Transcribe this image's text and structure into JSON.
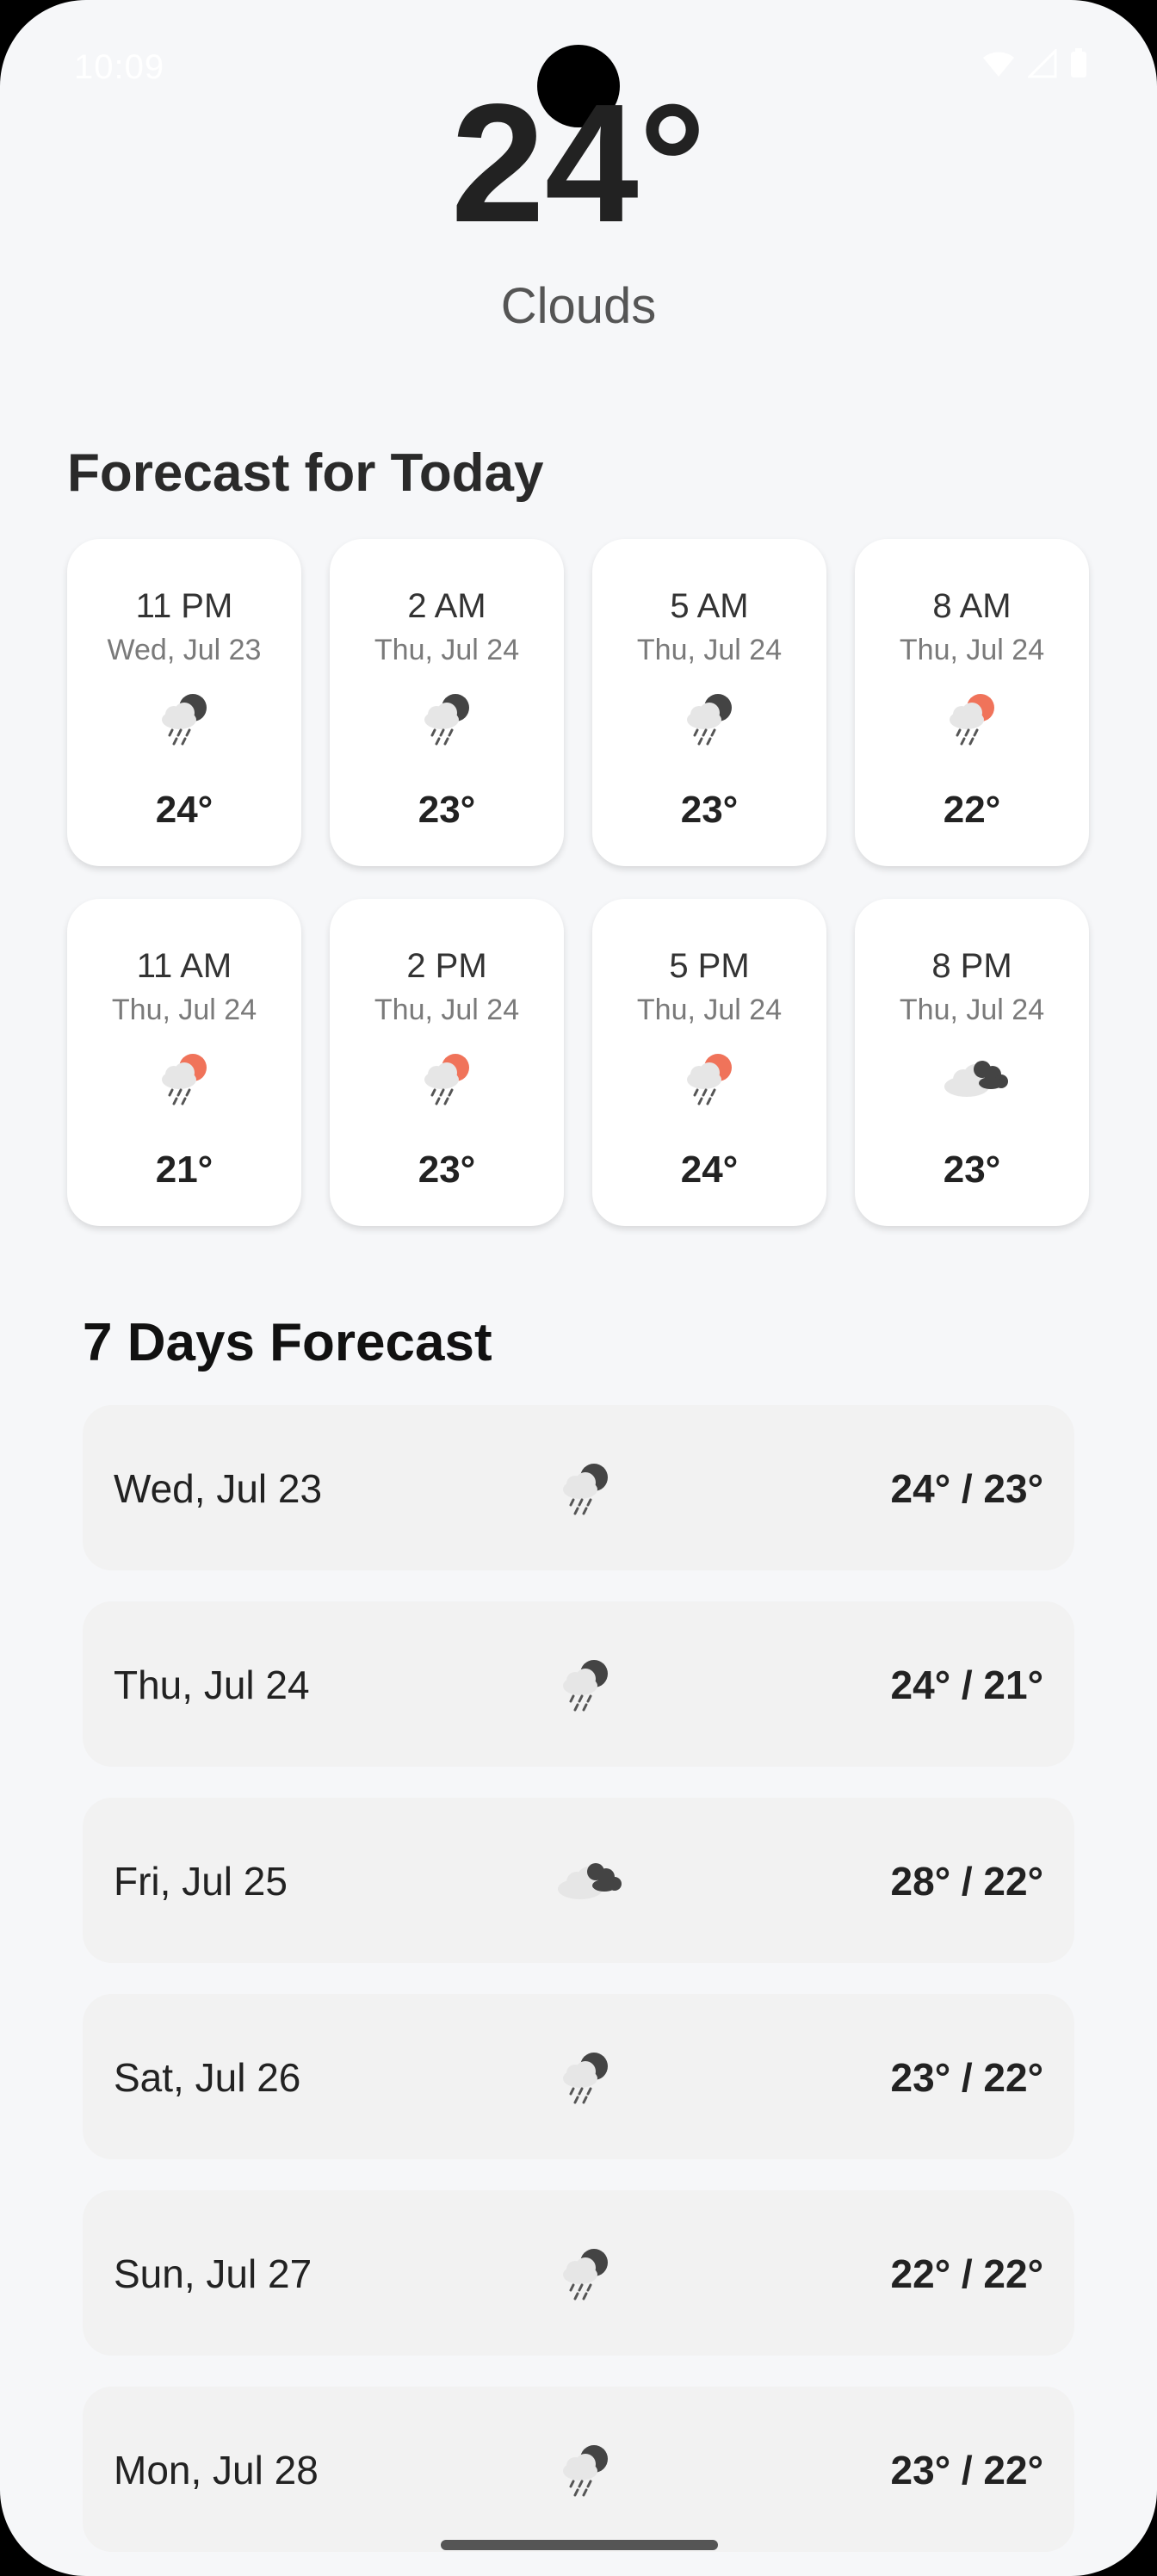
{
  "status_bar": {
    "time": "10:09"
  },
  "current": {
    "temperature": "24°",
    "condition": "Clouds"
  },
  "today": {
    "title": "Forecast for Today",
    "hours": [
      {
        "time": "11 PM",
        "date": "Wed, Jul 23",
        "icon": "rain-night-icon",
        "temp": "24°"
      },
      {
        "time": "2 AM",
        "date": "Thu, Jul 24",
        "icon": "rain-night-icon",
        "temp": "23°"
      },
      {
        "time": "5 AM",
        "date": "Thu, Jul 24",
        "icon": "rain-night-icon",
        "temp": "23°"
      },
      {
        "time": "8 AM",
        "date": "Thu, Jul 24",
        "icon": "rain-sun-icon",
        "temp": "22°"
      },
      {
        "time": "11 AM",
        "date": "Thu, Jul 24",
        "icon": "rain-sun-icon",
        "temp": "21°"
      },
      {
        "time": "2 PM",
        "date": "Thu, Jul 24",
        "icon": "rain-sun-icon",
        "temp": "23°"
      },
      {
        "time": "5 PM",
        "date": "Thu, Jul 24",
        "icon": "rain-sun-icon",
        "temp": "24°"
      },
      {
        "time": "8 PM",
        "date": "Thu, Jul 24",
        "icon": "cloudy-night-icon",
        "temp": "23°"
      }
    ]
  },
  "week": {
    "title": "7 Days Forecast",
    "days": [
      {
        "day": "Wed, Jul 23",
        "icon": "rain-night-icon",
        "range": "24° / 23°"
      },
      {
        "day": "Thu, Jul 24",
        "icon": "rain-night-icon",
        "range": "24° / 21°"
      },
      {
        "day": "Fri, Jul 25",
        "icon": "cloudy-night-icon",
        "range": "28° / 22°"
      },
      {
        "day": "Sat, Jul 26",
        "icon": "rain-night-icon",
        "range": "23° / 22°"
      },
      {
        "day": "Sun, Jul 27",
        "icon": "rain-night-icon",
        "range": "22° / 22°"
      },
      {
        "day": "Mon, Jul 28",
        "icon": "rain-night-icon",
        "range": "23° / 22°"
      }
    ]
  },
  "colors": {
    "background": "#f6f7f9",
    "card": "#ffffff",
    "row": "#f2f2f2",
    "sun": "#f0735a",
    "dark_cloud": "#444444",
    "light_cloud": "#e6e6e6"
  }
}
